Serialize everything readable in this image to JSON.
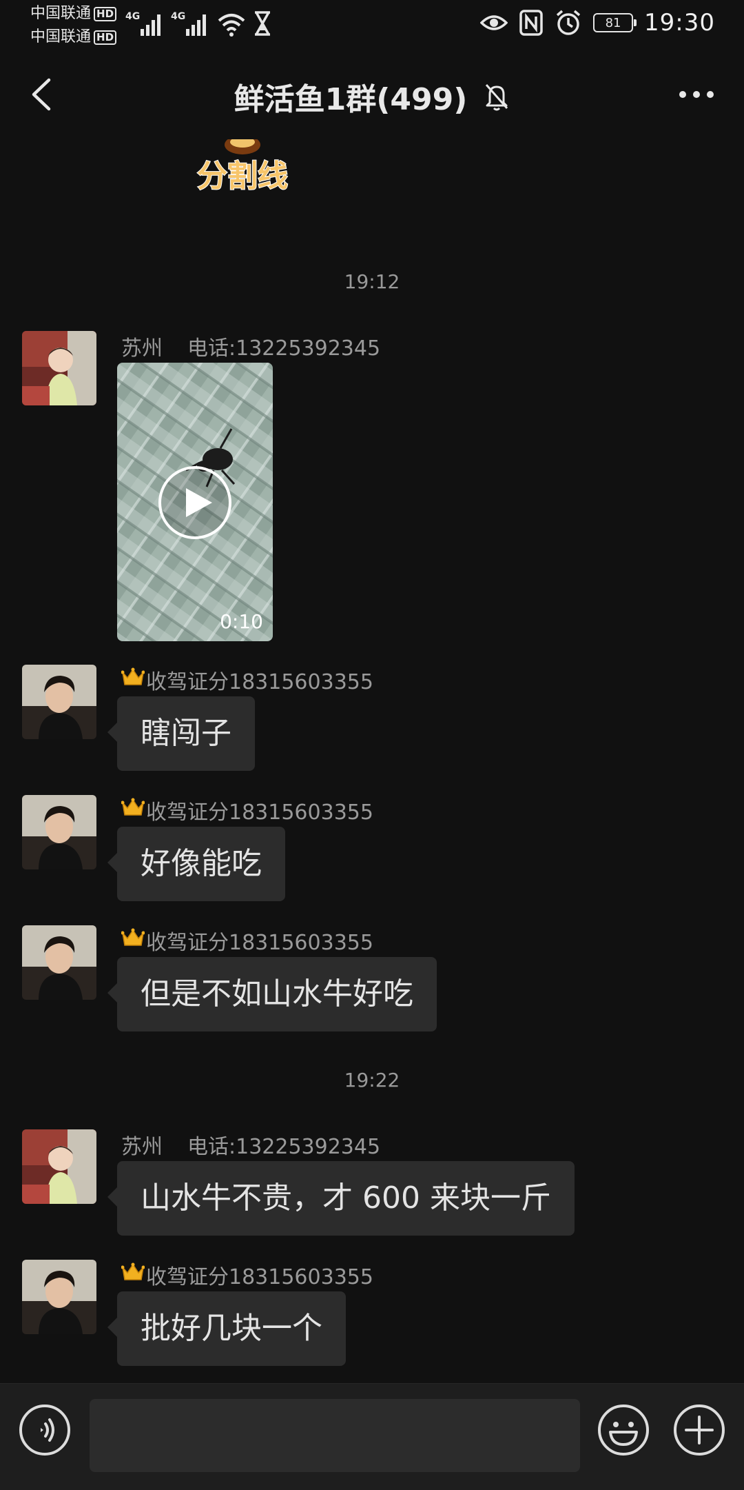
{
  "status_bar": {
    "carrier1": "中国联通",
    "carrier2": "中国联通",
    "hd": "HD",
    "net1": "4G",
    "net2": "4G",
    "battery": "81",
    "time": "19:30"
  },
  "header": {
    "title": "鲜活鱼1群(499)",
    "back_icon": "chevron-left-icon",
    "mute_icon": "bell-off-icon",
    "more_icon": "more-dots-icon"
  },
  "sticker": {
    "text": "分割线"
  },
  "messages": [
    {
      "type": "timestamp",
      "text": "19:12"
    },
    {
      "type": "video",
      "sender_name": "苏州",
      "sender_phone": "电话:13225392345",
      "duration": "0:10"
    },
    {
      "type": "text",
      "sender_name": "收驾证分18315603355",
      "text": "瞎闯子"
    },
    {
      "type": "text",
      "sender_name": "收驾证分18315603355",
      "text": "好像能吃"
    },
    {
      "type": "text",
      "sender_name": "收驾证分18315603355",
      "text": "但是不如山水牛好吃"
    },
    {
      "type": "timestamp",
      "text": "19:22"
    },
    {
      "type": "text",
      "sender_name": "苏州",
      "sender_phone": "电话:13225392345",
      "text": "山水牛不贵，才 600 来块一斤"
    },
    {
      "type": "text",
      "sender_name": "收驾证分18315603355",
      "text": "批好几块一个"
    }
  ],
  "input_bar": {
    "value": "",
    "voice_icon": "voice-icon",
    "emoji_icon": "emoji-icon",
    "plus_icon": "plus-icon"
  },
  "colors": {
    "background": "#111111",
    "bubble": "#2c2c2c",
    "secondary_text": "#9a9a9a",
    "primary_text": "#e4e4e4"
  }
}
